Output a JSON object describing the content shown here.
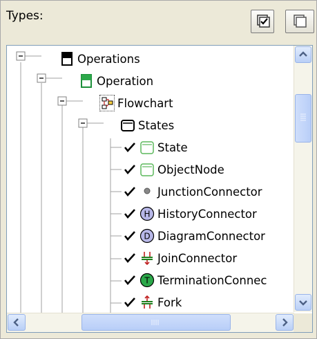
{
  "header": {
    "label": "Types:"
  },
  "tree": {
    "nodes": [
      {
        "label": "Operations"
      },
      {
        "label": "Operation"
      },
      {
        "label": "Flowchart"
      },
      {
        "label": "States"
      },
      {
        "label": "State",
        "checked": true
      },
      {
        "label": "ObjectNode",
        "checked": true
      },
      {
        "label": "JunctionConnector",
        "checked": true
      },
      {
        "label": "HistoryConnector",
        "checked": true,
        "icon_letter": "H"
      },
      {
        "label": "DiagramConnector",
        "checked": true,
        "icon_letter": "D"
      },
      {
        "label": "JoinConnector",
        "checked": true
      },
      {
        "label": "TerminationConnec",
        "checked": true,
        "icon_letter": "T"
      },
      {
        "label": "Fork",
        "checked": true
      }
    ]
  },
  "colors": {
    "selection_border": "#7f9db9",
    "green_icon": "#2ca84a",
    "state_green": "#5cb85c",
    "red_connector": "#c02020"
  }
}
